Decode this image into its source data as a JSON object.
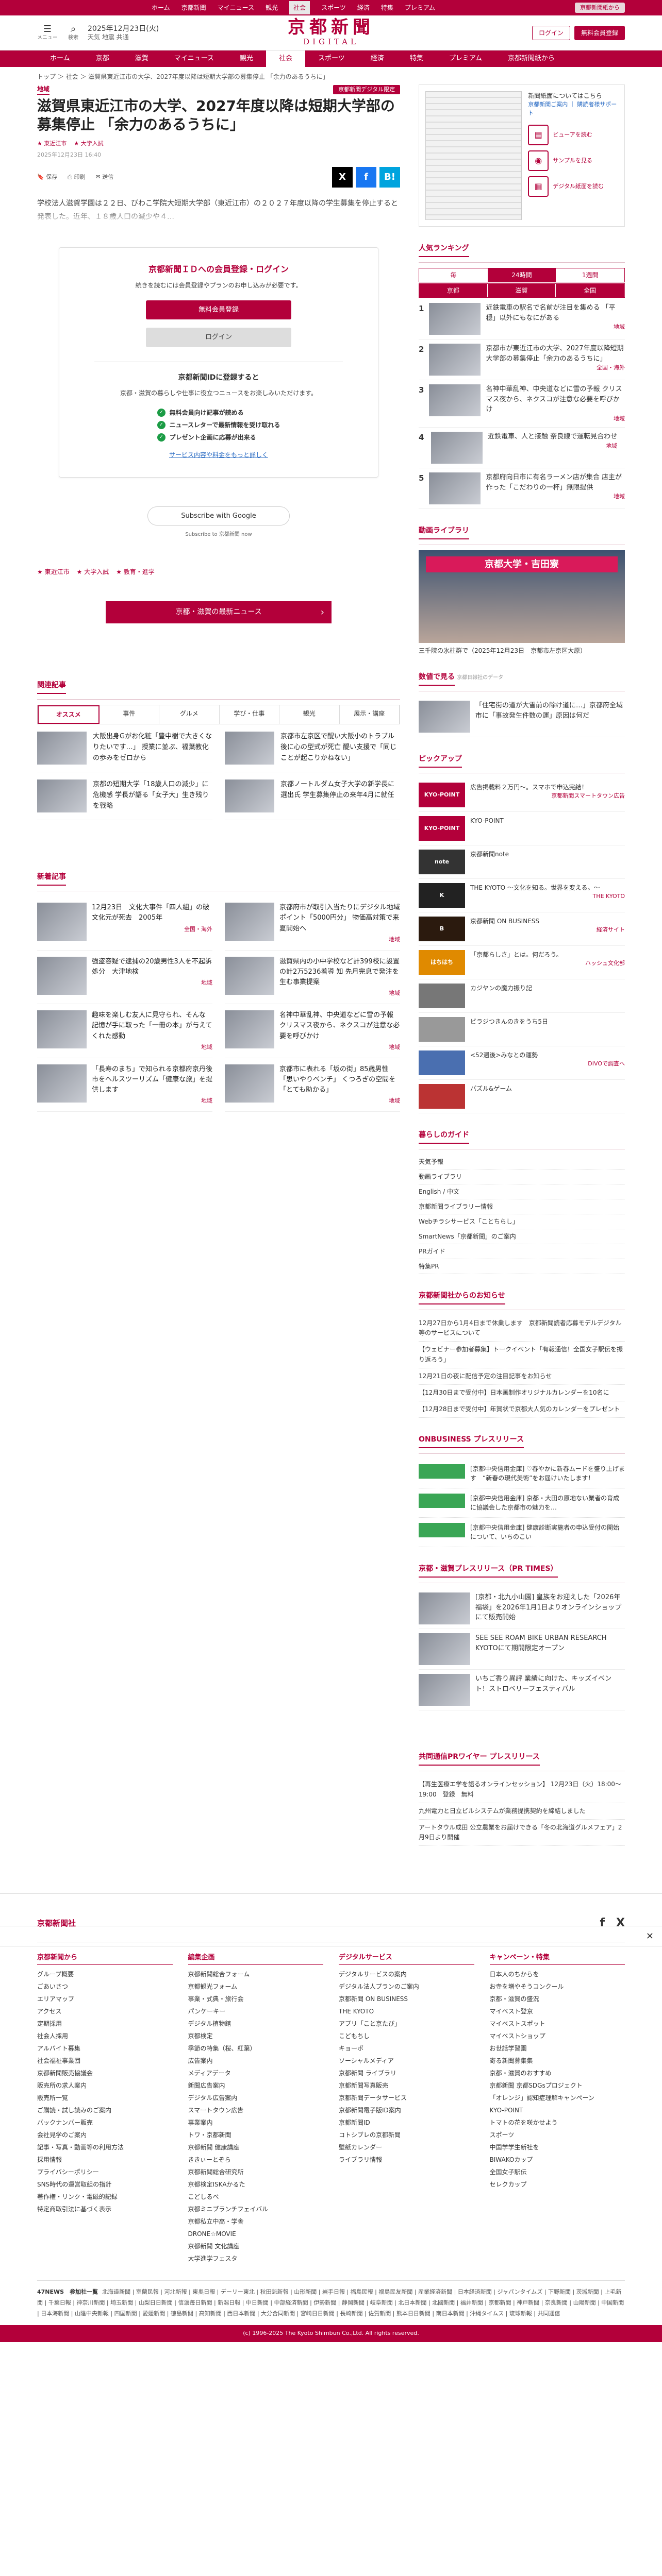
{
  "topbar": {
    "items": [
      "ホーム",
      "京都新聞",
      "マイニュース",
      "観光",
      "社会",
      "スポーツ",
      "経済",
      "特集",
      "プレミアム"
    ],
    "pill": "京都新聞紙から"
  },
  "header": {
    "menu": "メニュー",
    "search": "検索",
    "date": "2025年12月23日(火)",
    "weather": "天気 地震 共通",
    "logo1": "京都新聞",
    "logo2": "DIGITAL",
    "login": "ログイン",
    "register": "無料会員登録"
  },
  "nav": [
    "ホーム",
    "京都",
    "滋賀",
    "マイニュース",
    "観光",
    "社会",
    "スポーツ",
    "経済",
    "特集",
    "プレミアム",
    "京都新聞紙から"
  ],
  "crumb": "トップ ＞ 社会 ＞ 滋賀県東近江市の大学、2027年度以降は短期大学部の募集停止 「余力のあるうちに」",
  "article": {
    "tag": "地域",
    "exclusive": "京都新聞デジタル限定",
    "title": "滋賀県東近江市の大学、2027年度以降は短期大学部の募集停止 「余力のあるうちに」",
    "meta": [
      "東近江市",
      "大学入試"
    ],
    "date": "2025年12月23日 16:40",
    "tools": [
      "保存",
      "印刷",
      "送信"
    ],
    "lead": "学校法人滋賀学園は２２日、びわこ学院大短期大学部（東近江市）の２０２７年度以降の学生募集を停止すると発表した。近年、１８歳人口の減少や４…"
  },
  "register": {
    "title": "京都新聞ＩＤへの会員登録・ログイン",
    "sub": "続きを読むには会員登録やプランのお申し込みが必要です。",
    "btn1": "無料会員登録",
    "btn2": "ログイン",
    "t2": "京都新聞IDに登録すると",
    "p2": "京都・滋賀の暮らしや仕事に役立つニュースをお楽しみいただけます。",
    "li": [
      "無料会員向け記事が読める",
      "ニュースレターで最新情報を受け取れる",
      "プレゼント企画に応募が出来る"
    ],
    "link": "サービス内容や料金をもっと詳しく"
  },
  "google": {
    "btn": "Subscribe with Google",
    "sub": "Subscribe to 京都新聞 now"
  },
  "tags": [
    "東近江市",
    "大学入試",
    "教育・進学"
  ],
  "newsbtn": "京都・滋賀の最新ニュース",
  "related": {
    "title": "関連記事",
    "tabs": [
      "オススメ",
      "事件",
      "グルメ",
      "学び・仕事",
      "観光",
      "展示・講座"
    ],
    "items": [
      {
        "t": "大阪出身Gがお化粧「豊中樹で大きくなりたいです…」 授業に並ぶ、福葉教化の歩みをゼロから"
      },
      {
        "t": "京都市左京区で醍い大阪小のトラブル後に心の型式が死亡 醍い支援で「同じことが起こりかねない」"
      },
      {
        "t": "京都の短期大学「18歳人口の減少」に危機感 学長が語る「女子大」生き残りを戦略"
      },
      {
        "t": "京都ノートルダム女子大学の新学長に選出氏 学生募集停止の来年4月に就任"
      }
    ]
  },
  "newest": {
    "title": "新着記事",
    "items": [
      {
        "t": "12月23日　文化大事件「四人組」の破文化元が死去　2005年",
        "g": "全国・海外"
      },
      {
        "t": "京都府市が取引入当たりにデジタル地域ポイント「5000円分」 物価高対策で来夏開始へ",
        "g": "地域"
      },
      {
        "t": "強盗容疑で逮捕の20歳男性3人を不起訴処分　大津地検",
        "g": "地域"
      },
      {
        "t": "滋賀県内の小中学校など計399校に設置の計2万5236着導 知 先月完息で発注を生む事業提案",
        "g": "地域"
      },
      {
        "t": "趣味を楽しむ友人に見守られ、そんな記憶が手に取った「一冊の本」が与えてくれた感動",
        "g": "地域"
      },
      {
        "t": "名神中華乱神、中央道などに雪の予報　クリスマス夜から、ネクスコが注意な必要を呼びかけ",
        "g": "地域"
      },
      {
        "t": "「長寿のまち」で知られる京都府京丹後市をヘルスツーリズム「健康な旅」を提供します",
        "g": "地域"
      },
      {
        "t": "京都市に表れる「坂の街」85歳男性「思いやりベンチ」 くつろぎの空間を「とても助かる」",
        "g": "地域"
      }
    ]
  },
  "side": {
    "paper": {
      "title": "新聞紙面についてはこちら",
      "link": "京都新聞ご案内 ｜ 購読者様サポート",
      "views": [
        "ビューアを読む",
        "サンプルを見る",
        "デジタル紙面を読む"
      ]
    },
    "rank": {
      "title": "人気ランキング",
      "tabs1": [
        "毎",
        "24時間",
        "1週間"
      ],
      "tabs2": [
        "京都",
        "滋賀",
        "全国"
      ],
      "items": [
        {
          "n": "1",
          "t": "近鉄電車の駅名で名前が注目を集める 「平穏」以外にもなにがある",
          "g": "地域"
        },
        {
          "t": "京都市が東近江市の大学、2027年度以降短期大学部の募集停止「余力のあるうちに」",
          "n": "2",
          "g": "全国・海外"
        },
        {
          "n": "3",
          "t": "名神中華乱神、中央道などに雪の予報 クリスマス夜から、ネクスコが注意な必要を呼びかけ",
          "g": "地域"
        },
        {
          "n": "4",
          "t": "近鉄電車、人と接触 奈良線で運転見合わせ",
          "g": "地域"
        },
        {
          "n": "5",
          "t": "京都府向日市に有名ラーメン店が集合 店主が作った「こだわりの一杯」無限提供",
          "g": "地域"
        }
      ]
    },
    "video": {
      "title": "動画ライブラリ",
      "vt": "京都大学・吉田寮",
      "cap": "三千院の氷柱群で（2025年12月23日　京都市左京区大原）"
    },
    "digest": {
      "title": "数値で見る",
      "sub": "京都日報社のデータ",
      "t": "「住宅街の道が大雪前の除け道に…」京都府全域市に「事故発生件数の運」原因は何だ"
    },
    "pickup": {
      "title": "ピックアップ",
      "items": [
        {
          "lg": "KYO-POINT",
          "t": "広告掲載料２万円〜。スマホで申込完結！",
          "s": "京都新聞スマートタウン広告"
        },
        {
          "lg": "KYO-POINT",
          "t": "KYO-POINT",
          "s": ""
        },
        {
          "lg": "note",
          "t": "京都新聞note",
          "s": ""
        },
        {
          "lg": "K",
          "t": "THE KYOTO 〜文化を知る。世界を変える。〜",
          "s": "THE KYOTO"
        },
        {
          "lg": "B",
          "t": "京都新聞 ON BUSINESS",
          "s": "経済サイト"
        },
        {
          "lg": "はちはち",
          "t": "「京都らしさ」とは。何だろう。",
          "s": "ハッシュ文化部"
        },
        {
          "lg": "",
          "t": "カジヤンの魔力振り記",
          "s": ""
        },
        {
          "lg": "",
          "t": "ビラジつきんのきをうち5日",
          "s": ""
        },
        {
          "lg": "",
          "t": "<52週後>みなとの運勢",
          "s": "DIVOで調査へ"
        },
        {
          "lg": "",
          "t": "パズル&ゲーム",
          "s": ""
        }
      ]
    },
    "guide": {
      "title": "暮らしのガイド",
      "items": [
        "天気予報",
        "動画ライブラリ",
        "English / 中文",
        "京都新聞ライブラリー情報",
        "Webチラシサービス「ことちらし」",
        "SmartNews「京都新聞」のご案内",
        "PRガイド",
        "特集PR"
      ]
    },
    "notice": {
      "title": "京都新聞社からのお知らせ",
      "items": [
        "12月27日から1月4日まで休業します　京都新聞読者応募モデルデジタル等のサービスについて",
        "【ウェビナー参加者募集】トークイベント「有報通信！全国女子駅伝を振り返ろう」",
        "12月21日の夜に配信予定の注目記事をお知らせ",
        "【12月30日まで受付中】日本画制作オリジナルカレンダーを10名に",
        "【12月28日まで受付中】年賀状で京都大人気のカレンダーをプレゼント"
      ]
    },
    "obp": {
      "title": "ONBUSINESS プレスリリース",
      "items": [
        "[京都中央信用金庫] ♡春やかに新春ムードを盛り上げます　“新春の現代美術”をお届けいたします！",
        "[京都中央信用金庫] 京都・大田の原地ない業者の育成に協議会した京都市の魅力を…",
        "[京都中央信用金庫] 健康診断実施者の申込受付の開始について、いちのこい"
      ]
    },
    "pr": {
      "title": "京都・滋賀プレスリリース（PR TIMES）",
      "items": [
        "[京都・北九小山園] 皇族をお迎えした「2026年福袋」を2026年1月1日よりオンラインショップにて販売開始",
        "SEE SEE ROAM BIKE URBAN RESEARCH KYOTOにて期間限定オープン",
        "いちご香り異評 業績に向けた、キッズイベント！ストロベリーフェスティバル"
      ]
    },
    "wire": {
      "title": "共同通信PRワイヤー プレスリリース",
      "items": [
        "【再生医療エ学を語るオンラインセッション】 12月23日（火）18:00〜19:00　登録　無料",
        "九州電力と日立ビルシステムが業務提携契約を締結しました",
        "アートタウル成田 公立農業をお届けできる「冬の北海道グルメフェア」2月9日より開催"
      ]
    }
  },
  "footer": {
    "logo": "京都新聞社",
    "social": [
      "f",
      "X"
    ],
    "cols": [
      {
        "h": "京都新聞から",
        "items": [
          "グループ概要",
          "ごあいさつ",
          "エリアマップ",
          "アクセス",
          "定期採用",
          "社会人採用",
          "アルバイト募集",
          "社会福祉事業団",
          "京都新聞販売協議会",
          "販売所の求人案内",
          "販売所一覧",
          "ご購読・試し読みのご案内",
          "バックナンバー販売",
          "会社見学のご案内",
          "記事・写真・動画等の利用方法",
          "採用情報",
          "プライバシーポリシー",
          "SNS時代の運営取組の指針",
          "著作権・リンク・電磁的記録",
          "特定商取引法に基づく表示"
        ]
      },
      {
        "h": "編集企画",
        "items": [
          "京都新聞総合フォーム",
          "京都観光フォーム",
          "事業・式典・旅行会",
          "パンケーキー",
          "デジタル植物館",
          "京都検定",
          "季節の特集（桜、紅葉）",
          "広告案内",
          "メディアデータ",
          "新聞広告案内",
          "デジタル広告案内",
          "スマートタウン広告",
          "事業案内",
          "トワ・京都新聞",
          "京都新聞 健康講座",
          "ききぃーとぞら",
          "京都新聞総合研究所",
          "京都検定ISKAかるた",
          "こどしるべ",
          "京都ミニブランチフェイバル",
          "京都私立中高・学舎",
          "DRONE☆MOVIE",
          "京都新聞 文化講座",
          "大学進学フェスタ"
        ]
      },
      {
        "h": "デジタルサービス",
        "items": [
          "デジタルサービスの案内",
          "デジタル法人プランのご案内",
          "京都新聞 ON BUSINESS",
          "THE KYOTO",
          "アプリ「こと京たび」",
          "こどもちし",
          "キョーポ",
          "ソーシャルメディア",
          "京都新聞 ライブラリ",
          "京都新聞写真販売",
          "京都新聞データサービス",
          "京都新聞電子版ID案内",
          "京都新聞ID",
          "コトシブレの京都新聞",
          "壁紙カレンダー",
          "ライブラリ情報"
        ]
      },
      {
        "h": "キャンペーン・特集",
        "items": [
          "日本人のちからを",
          "お寺を増やそうコンクール",
          "京都・滋賀の盛況",
          "マイベスト登京",
          "マイベストスポット",
          "マイベストショップ",
          "お世話学習園",
          "寄る新聞募集集",
          "京都・滋賀のおすすめ",
          "京都新聞 京都SDGsプロジェクト",
          "「オレンジ」認知症理解キャンペーン",
          "KYO-POINT",
          "トマトの花を咲かせよう",
          "スポーツ",
          "中国学学生新社を",
          "BIWAKOカップ",
          "全国女子駅伝",
          "セレクカップ"
        ]
      }
    ],
    "network_label": "47NEWS　参加社一覧",
    "network": "北海道新聞 | 室蘭民報 | 河北新報 | 東奥日報 | デーリー東北 | 秋田魁新報 | 山形新聞 | 岩手日報 | 福島民報 | 福島民友新聞 | 産業経済新聞 | 日本経済新聞 | ジャパンタイムズ | 下野新聞 | 茨城新聞 | 上毛新聞 | 千葉日報 | 神奈川新聞 | 埼玉新聞 | 山梨日日新聞 | 信濃毎日新聞 | 新潟日報 | 中日新聞 | 中部経済新聞 | 伊勢新聞 | 静岡新聞 | 岐阜新聞 | 北日本新聞 | 北國新聞 | 福井新聞 | 京都新聞 | 神戸新聞 | 奈良新聞 | 山陽新聞 | 中国新聞 | 日本海新聞 | 山陰中央新報 | 四国新聞 | 愛媛新聞 | 徳島新聞 | 高知新聞 | 西日本新聞 | 大分合同新聞 | 宮崎日日新聞 | 長崎新聞 | 佐賀新聞 | 熊本日日新聞 | 南日本新聞 | 沖縄タイムス | 琉球新報 | 共同通信",
    "copy": "(c) 1996-2025 The Kyoto Shimbun Co.,Ltd. All rights reserved."
  }
}
